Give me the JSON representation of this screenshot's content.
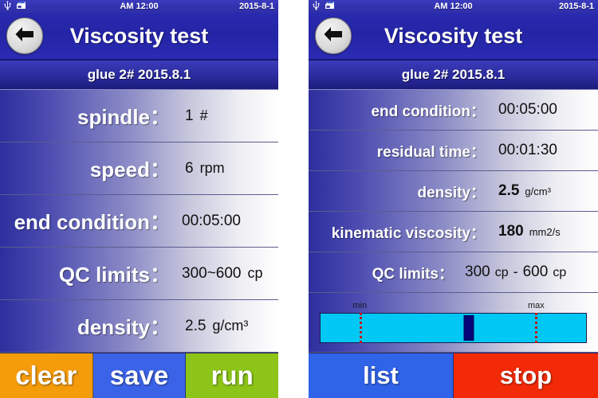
{
  "colors": {
    "status_bar": "#3333b0",
    "title_bar": "#2424a6",
    "sample_bar": "#2b2b9e",
    "row_gradient_start": "#2e2e9e",
    "row_gradient_end": "#ffffff",
    "gauge_track": "#00c8f5",
    "gauge_marker": "#06067a",
    "gauge_limit": "#c01818",
    "btn_clear": "#f59c0b",
    "btn_save": "#3b63e8",
    "btn_run": "#8cc417",
    "btn_list": "#2f63e8",
    "btn_stop": "#f32a07"
  },
  "left_panel": {
    "status": {
      "usb_icon": "usb-icon",
      "device_icon": "printer-icon",
      "time": "AM 12:00",
      "date": "2015-8-1"
    },
    "header": {
      "back_icon": "back-arrow-icon",
      "title": "Viscosity test",
      "sample": "glue 2# 2015.8.1"
    },
    "rows": [
      {
        "label": "spindle：",
        "value": "1",
        "unit": "#"
      },
      {
        "label": "speed：",
        "value": "6",
        "unit": "rpm"
      },
      {
        "label": "end condition：",
        "value": "00:05:00",
        "unit": ""
      },
      {
        "label": "QC limits：",
        "value": "300~600",
        "unit": "cp"
      },
      {
        "label": "density：",
        "value": "2.5",
        "unit": "g/cm³"
      }
    ],
    "actions": [
      {
        "label": "clear",
        "color": "#f59c0b"
      },
      {
        "label": "save",
        "color": "#3b63e8"
      },
      {
        "label": "run",
        "color": "#8cc417"
      }
    ]
  },
  "right_panel": {
    "status": {
      "usb_icon": "usb-icon",
      "device_icon": "printer-icon",
      "time": "AM 12:00",
      "date": "2015-8-1"
    },
    "header": {
      "back_icon": "back-arrow-icon",
      "title": "Viscosity test",
      "sample": "glue 2# 2015.8.1"
    },
    "rows": [
      {
        "label": "end condition：",
        "value": "00:05:00",
        "unit": "",
        "bold": false
      },
      {
        "label": "residual time：",
        "value": "00:01:30",
        "unit": "",
        "bold": false
      },
      {
        "label": "density：",
        "value": "2.5",
        "unit": "g/cm³",
        "bold": true
      },
      {
        "label": "kinematic viscosity：",
        "value": "180",
        "unit": "mm2/s",
        "bold": true
      }
    ],
    "qc": {
      "label": "QC limits：",
      "min_value": "300",
      "min_unit": "cp",
      "separator": "-",
      "max_value": "600",
      "max_unit": "cp"
    },
    "gauge": {
      "min_label": "min",
      "max_label": "max",
      "min_pct": 15,
      "max_pct": 81,
      "marker_pct": 56
    },
    "actions": [
      {
        "label": "list",
        "color": "#2f63e8"
      },
      {
        "label": "stop",
        "color": "#f32a07"
      }
    ]
  }
}
